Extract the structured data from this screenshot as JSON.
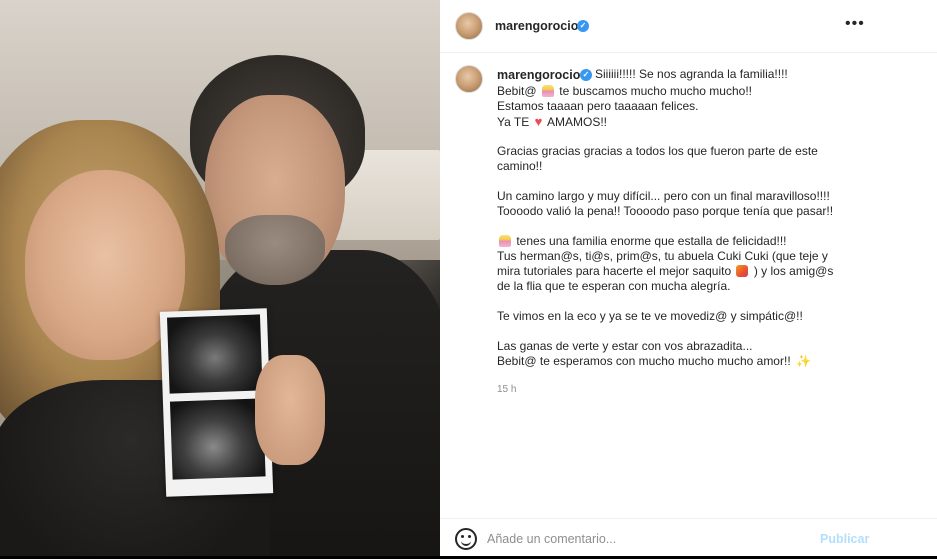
{
  "post": {
    "username": "marengorocio",
    "more_icon": "•••"
  },
  "caption": {
    "first_line": "Siiiiii!!!!! Se nos agranda la familia!!!!",
    "line_2a": "Bebit@",
    "line_2b": "te buscamos mucho mucho mucho!!",
    "line_3": "Estamos taaaan pero taaaaan felices.",
    "line_4a": "Ya TE",
    "line_4b": "AMAMOS!!",
    "line_5": "Gracias gracias gracias a todos los que fueron parte de este",
    "line_6": "camino!!",
    "line_7": "Un camino largo y muy difícil... pero con un final maravilloso!!!!",
    "line_8": "Toooodo valió la pena!! Toooodo paso porque tenía que pasar!!",
    "line_9": "tenes una familia enorme que estalla de felicidad!!!",
    "line_10": "Tus herman@s, ti@s, prim@s, tu abuela Cuki Cuki (que teje y",
    "line_11a": "mira tutoriales para hacerte el mejor saquito",
    "line_11b": ") y los amig@s",
    "line_12": "de la flia que te esperan con mucha alegría.",
    "line_13": "Te vimos en la eco y ya se te ve movediz@ y simpátic@!!",
    "line_14": "Las ganas de verte y estar con vos abrazadita...",
    "line_15": "Bebit@ te esperamos con mucho mucho mucho amor!!",
    "timestamp": "15 h"
  },
  "comment": {
    "placeholder": "Añade un comentario...",
    "publish_label": "Publicar"
  },
  "icons": {
    "verified": "verified-badge-icon",
    "emoji": "smile-icon",
    "more": "more-options-icon"
  },
  "colors": {
    "verified": "#3897f0",
    "publish": "#b2dffc",
    "heart": "#ed4956"
  }
}
